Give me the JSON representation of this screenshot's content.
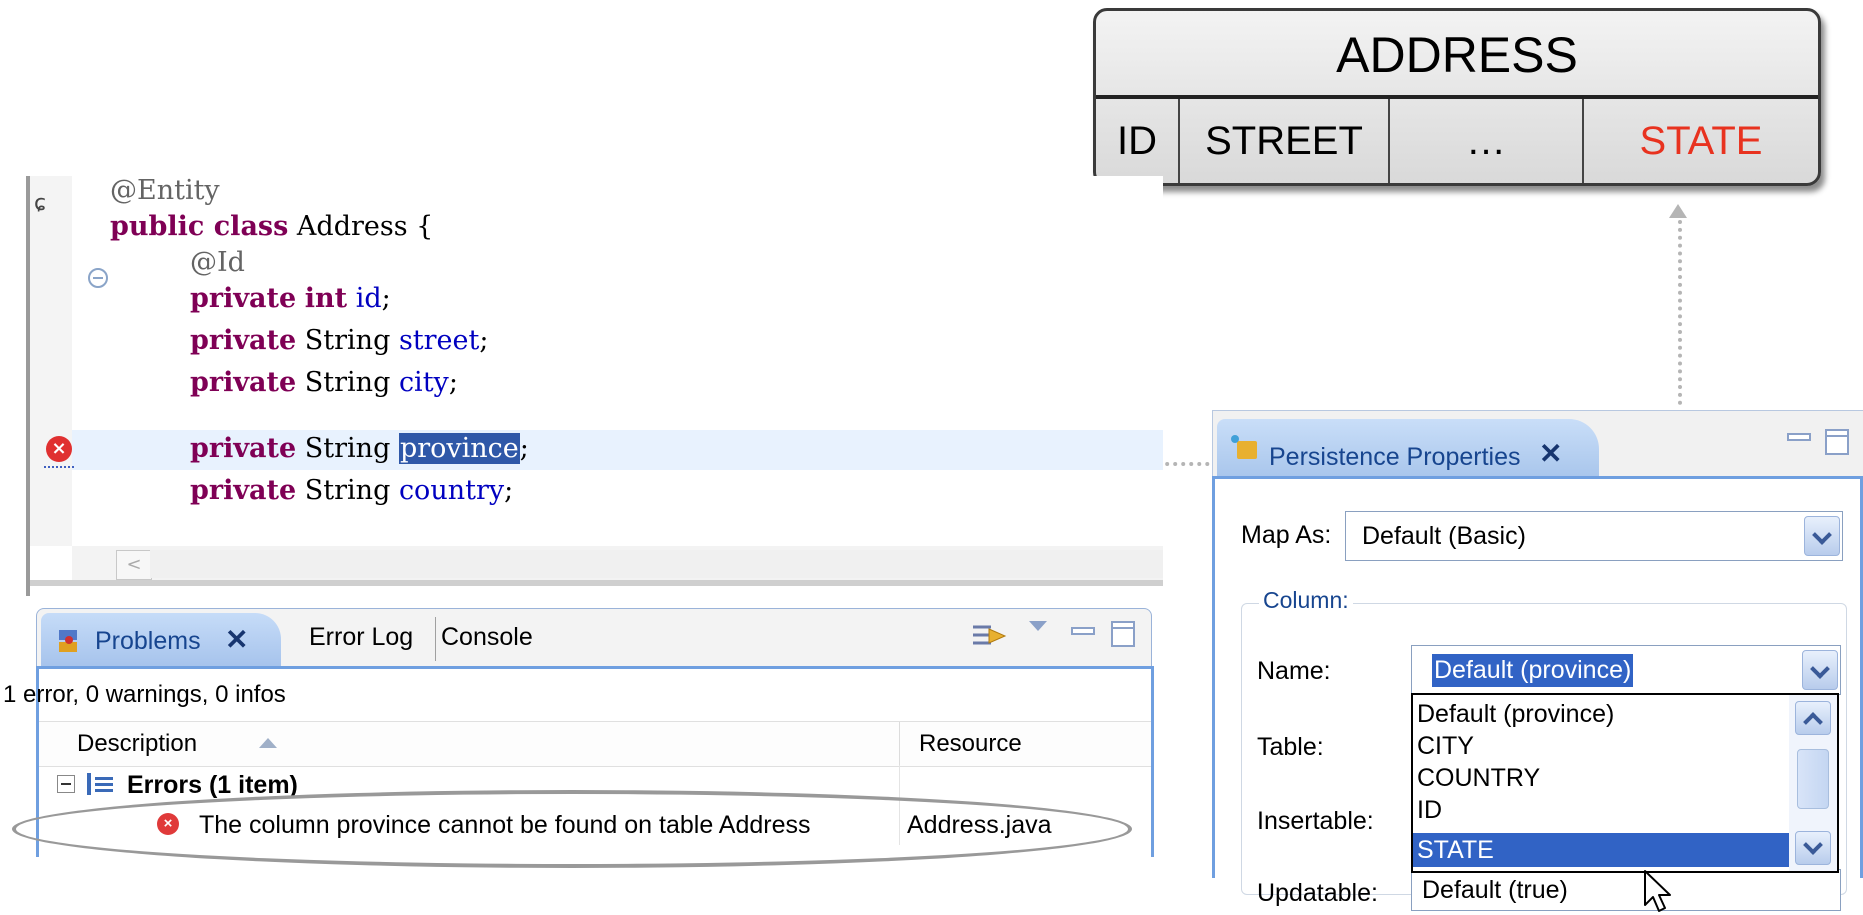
{
  "address_table": {
    "title": "ADDRESS",
    "columns": [
      "ID",
      "STREET",
      "…",
      "STATE"
    ],
    "highlight_color": "#e8321f"
  },
  "editor": {
    "code": {
      "l1": "@Entity",
      "l2_kw": "public class",
      "l2_rest": " Address {",
      "l3": "@Id",
      "l4_kw1": "private",
      "l4_kw2": "int",
      "l4_field": "id",
      "l5_kw": "private",
      "l5_type": " String ",
      "l5_field": "street",
      "l6_kw": "private",
      "l6_type": " String ",
      "l6_field": "city",
      "l7_kw": "private",
      "l7_type": " String ",
      "l7_field": "province",
      "l8_kw": "private",
      "l8_type": " String ",
      "l8_field": "country"
    },
    "icons": [
      "quick-diff-icon",
      "fold-icon",
      "error-marker-icon",
      "scroll-left-icon"
    ]
  },
  "problems_view": {
    "tabs": [
      "Problems",
      "Error Log",
      "Console"
    ],
    "summary": "1 error, 0 warnings, 0 infos",
    "columns": [
      "Description",
      "Resource"
    ],
    "group": "Errors (1 item)",
    "error": {
      "description": "The column province cannot be found on table Address",
      "resource": "Address.java"
    }
  },
  "persistence_properties": {
    "tab": "Persistence Properties",
    "map_as_label": "Map As:",
    "map_as_value": "Default (Basic)",
    "column_group": "Column:",
    "labels": {
      "name": "Name:",
      "table": "Table:",
      "insertable": "Insertable:",
      "updatable": "Updatable:"
    },
    "name_value": "Default (province)",
    "updatable_value": "Default (true)",
    "dropdown_items": [
      "Default (province)",
      "CITY",
      "COUNTRY",
      "ID",
      "STATE"
    ],
    "selected_item": "STATE"
  },
  "colors": {
    "keyword": "#7f0055",
    "field": "#0000c0",
    "annotation": "#646464",
    "selection": "#3163c5",
    "view_border": "#6f9fe0"
  }
}
